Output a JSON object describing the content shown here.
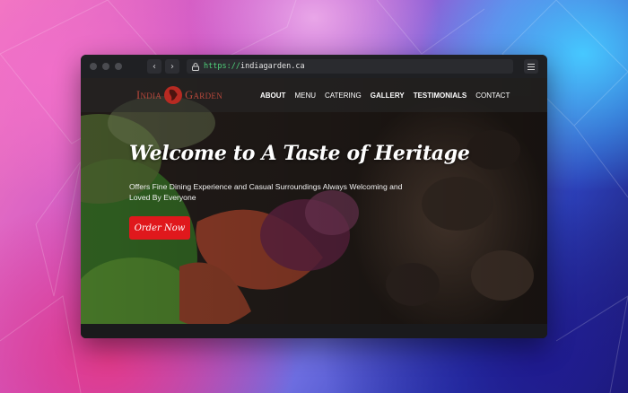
{
  "browser": {
    "url_scheme": "https://",
    "url_host": "indiagarden.ca",
    "back_label": "‹",
    "forward_label": "›"
  },
  "site": {
    "logo_left": "India",
    "logo_right": "Garden",
    "nav": [
      {
        "label": "About",
        "bold": true
      },
      {
        "label": "Menu",
        "bold": false
      },
      {
        "label": "Catering",
        "bold": false
      },
      {
        "label": "Gallery",
        "bold": true
      },
      {
        "label": "Testimonials",
        "bold": true
      },
      {
        "label": "Contact",
        "bold": false
      }
    ]
  },
  "hero": {
    "title": "Welcome to A Taste of Heritage",
    "subtitle": "Offers Fine Dining Experience and Casual Surroundings Always Welcoming and Loved By Everyone",
    "cta_label": "Order Now"
  },
  "colors": {
    "accent": "#e0181c",
    "logo": "#b7473b",
    "url_scheme": "#4fd17a"
  },
  "icons": [
    "lock-icon",
    "hamburger-menu-icon",
    "logo-emblem-icon"
  ]
}
